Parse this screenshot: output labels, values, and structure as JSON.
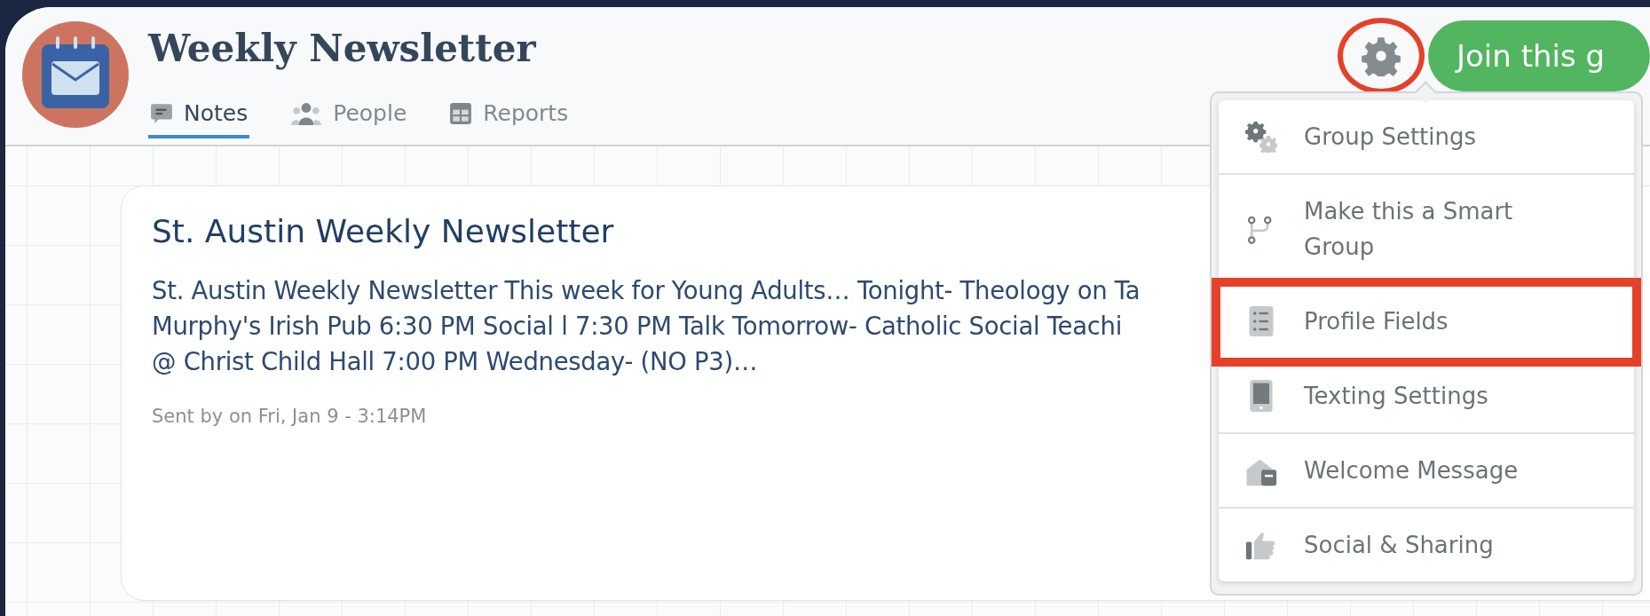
{
  "group": {
    "title": "Weekly Newsletter"
  },
  "tabs": [
    {
      "label": "Notes",
      "selected": true
    },
    {
      "label": "People",
      "selected": false
    },
    {
      "label": "Reports",
      "selected": false
    }
  ],
  "settings_button": {
    "annotated": true
  },
  "join_button": {
    "label": "Join this g"
  },
  "note": {
    "title": "St. Austin Weekly Newsletter",
    "body_lines": [
      "St. Austin Weekly Newsletter This week for Young Adults… Tonight- Theology on Ta",
      "Murphy's Irish Pub 6:30 PM Social l 7:30 PM Talk Tomorrow- Catholic Social Teachi",
      "@ Christ Child Hall 7:00 PM Wednesday- (NO P3)…"
    ],
    "meta": "Sent by on Fri, Jan 9 - 3:14PM"
  },
  "settings_menu": [
    {
      "label": "Group Settings",
      "annotated": false
    },
    {
      "label": "Make this a Smart Group",
      "annotated": false
    },
    {
      "label": "Profile Fields",
      "annotated": true
    },
    {
      "label": "Texting Settings",
      "annotated": false
    },
    {
      "label": "Welcome Message",
      "annotated": false
    },
    {
      "label": "Social & Sharing",
      "annotated": false
    }
  ]
}
